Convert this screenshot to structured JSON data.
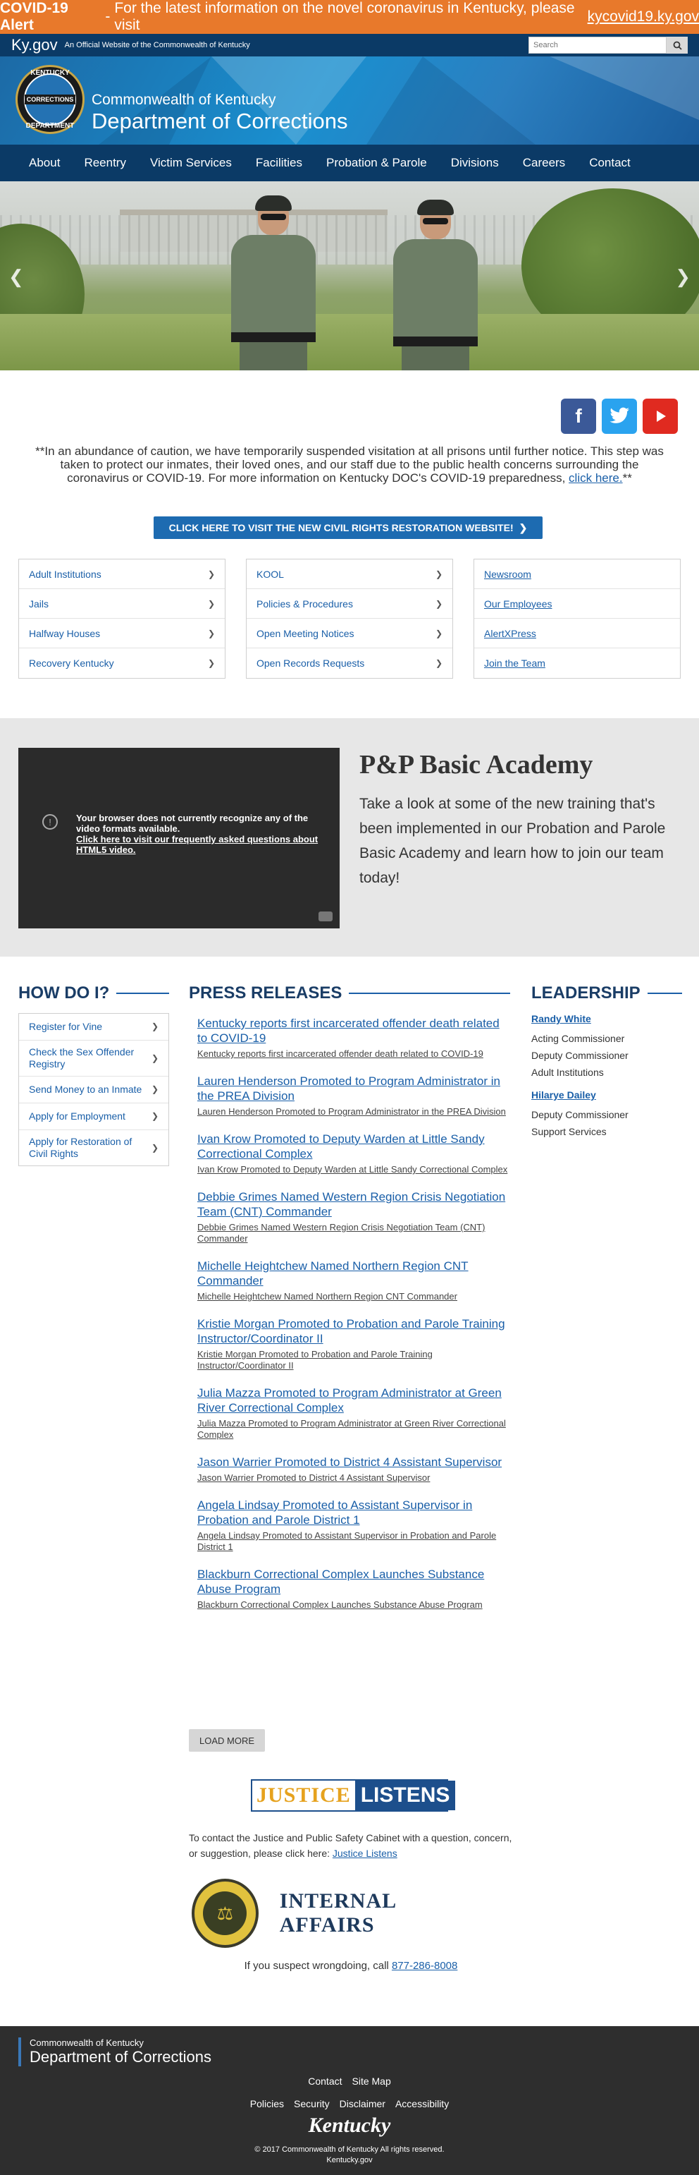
{
  "alert": {
    "label": "COVID-19 Alert",
    "sep": "-",
    "message": "For the latest information on the novel coronavirus in Kentucky, please visit",
    "link": "kycovid19.ky.gov"
  },
  "kybar": {
    "logo": "Ky.gov",
    "tagline": "An Official Website of the Commonwealth of Kentucky",
    "search_placeholder": "Search"
  },
  "header": {
    "seal_top": "KENTUCKY",
    "seal_band": "CORRECTIONS",
    "seal_bottom": "DEPARTMENT",
    "line1": "Commonwealth of Kentucky",
    "line2": "Department of Corrections"
  },
  "nav": [
    "About",
    "Reentry",
    "Victim Services",
    "Facilities",
    "Probation & Parole",
    "Divisions",
    "Careers",
    "Contact"
  ],
  "notice": {
    "text": "**In an abundance of caution, we have temporarily suspended visitation at all prisons until further notice. This step was taken to protect our inmates, their loved ones, and our staff due to the public health concerns surrounding the coronavirus or COVID-19.  For more information on Kentucky DOC's COVID-19 preparedness,",
    "link": "click here.",
    "end": "**"
  },
  "civil_rights_button": "CLICK HERE TO VISIT THE NEW CIVIL RIGHTS RESTORATION WEBSITE!",
  "link_columns": [
    [
      "Adult Institutions",
      "Jails",
      "Halfway Houses",
      "Recovery Kentucky"
    ],
    [
      "KOOL",
      "Policies & Procedures",
      "Open Meeting Notices",
      "Open Records Requests"
    ],
    [
      "Newsroom",
      "Our Employees",
      "AlertXPress",
      "Join the Team"
    ]
  ],
  "academy": {
    "video_message": "Your browser does not currently recognize any of the video formats available.",
    "video_link": "Click here to visit our frequently asked questions about HTML5 video.",
    "title": "P&P Basic Academy",
    "description": "Take a look at some of the new training that's been implemented in our Probation and Parole Basic Academy and learn how to join our team today!"
  },
  "how_do_i": {
    "title": "HOW DO I?",
    "items": [
      "Register for Vine",
      "Check the Sex Offender Registry",
      "Send Money to an Inmate",
      "Apply for Employment",
      "Apply for Restoration of Civil Rights"
    ]
  },
  "press": {
    "title": "PRESS RELEASES",
    "items": [
      {
        "title": "Kentucky reports first incarcerated offender death related to COVID-19",
        "summary": "Kentucky reports first incarcerated offender death related to COVID-19"
      },
      {
        "title": "Lauren Henderson Promoted to Program Administrator in the PREA Division",
        "summary": "Lauren Henderson Promoted to Program Administrator in the PREA Division"
      },
      {
        "title": "Ivan Krow Promoted to Deputy Warden at Little Sandy Correctional Complex",
        "summary": "Ivan Krow Promoted to Deputy Warden at Little Sandy Correctional Complex"
      },
      {
        "title": "Debbie Grimes Named Western Region Crisis Negotiation Team (CNT) Commander",
        "summary": "Debbie Grimes Named Western Region Crisis Negotiation Team (CNT) Commander"
      },
      {
        "title": "Michelle Heightchew Named Northern Region CNT Commander",
        "summary": "Michelle Heightchew Named Northern Region CNT Commander"
      },
      {
        "title": "Kristie Morgan Promoted to Probation and Parole Training Instructor/Coordinator II",
        "summary": "Kristie Morgan Promoted to Probation and Parole Training Instructor/Coordinator II"
      },
      {
        "title": "Julia Mazza Promoted to Program Administrator at Green River Correctional Complex",
        "summary": "Julia Mazza Promoted to Program Administrator at Green River Correctional Complex"
      },
      {
        "title": "Jason Warrier Promoted to District 4 Assistant Supervisor",
        "summary": "Jason Warrier Promoted to District 4 Assistant Supervisor"
      },
      {
        "title": "Angela Lindsay Promoted to Assistant Supervisor in Probation and Parole District 1",
        "summary": "Angela Lindsay Promoted to Assistant Supervisor in Probation and Parole District 1"
      },
      {
        "title": "Blackburn Correctional Complex Launches Substance Abuse Program",
        "summary": "Blackburn Correctional Complex Launches Substance Abuse Program"
      }
    ],
    "load_more": "LOAD MORE"
  },
  "leadership": {
    "title": "LEADERSHIP",
    "people": [
      {
        "name": "Randy White",
        "roles": [
          "Acting Commissioner",
          "Deputy Commissioner",
          "Adult Institutions"
        ]
      },
      {
        "name": "Hilarye Dailey",
        "roles": [
          "Deputy Commissioner",
          "Support Services"
        ]
      }
    ]
  },
  "justice": {
    "logo_left": "JUSTICE",
    "logo_right": "LISTENS",
    "text": "To contact the Justice and Public Safety Cabinet with a question, concern, or suggestion, please click here:",
    "link": "Justice Listens"
  },
  "internal_affairs": {
    "title": "INTERNAL AFFAIRS",
    "text": "If you suspect wrongdoing, call",
    "phone": "877-286-8008"
  },
  "footer": {
    "line1": "Commonwealth of Kentucky",
    "line2": "Department of Corrections",
    "links1": [
      "Contact",
      "Site Map"
    ],
    "links2": [
      "Policies",
      "Security",
      "Disclaimer",
      "Accessibility"
    ],
    "logo": "Kentucky",
    "copyright": "© 2017 Commonwealth of Kentucky All rights reserved.",
    "site": "Kentucky.gov"
  },
  "colors": {
    "alert": "#e8792b",
    "navy": "#0b3a66",
    "link": "#1a5fa8",
    "facebook": "#3b5998",
    "twitter": "#2aa3ef",
    "youtube": "#e02a20"
  }
}
